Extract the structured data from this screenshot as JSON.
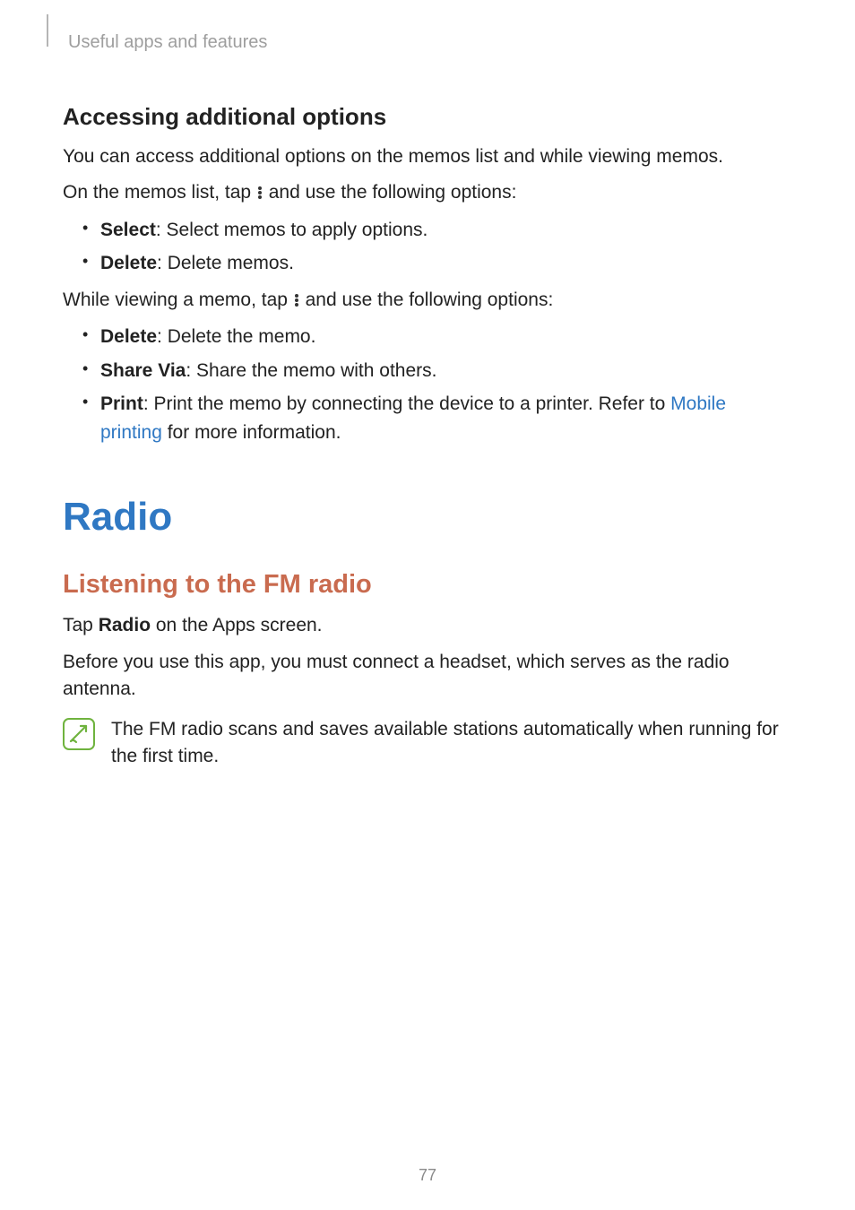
{
  "header": {
    "breadcrumb": "Useful apps and features"
  },
  "section1": {
    "heading": "Accessing additional options",
    "p1": "You can access additional options on the memos list and while viewing memos.",
    "p2a": "On the memos list, tap ",
    "p2b": " and use the following options:",
    "list1": [
      {
        "bold": "Select",
        "rest": ": Select memos to apply options."
      },
      {
        "bold": "Delete",
        "rest": ": Delete memos."
      }
    ],
    "p3a": "While viewing a memo, tap ",
    "p3b": " and use the following options:",
    "list2": [
      {
        "bold": "Delete",
        "rest": ": Delete the memo."
      },
      {
        "bold": "Share Via",
        "rest": ": Share the memo with others."
      },
      {
        "bold": "Print",
        "rest_a": ": Print the memo by connecting the device to a printer. Refer to ",
        "link": "Mobile printing",
        "rest_b": " for more information."
      }
    ]
  },
  "section2": {
    "h1": "Radio",
    "h2": "Listening to the FM radio",
    "p1a": "Tap ",
    "p1bold": "Radio",
    "p1b": " on the Apps screen.",
    "p2": "Before you use this app, you must connect a headset, which serves as the radio antenna.",
    "info": "The FM radio scans and saves available stations automatically when running for the first time."
  },
  "page_number": "77"
}
